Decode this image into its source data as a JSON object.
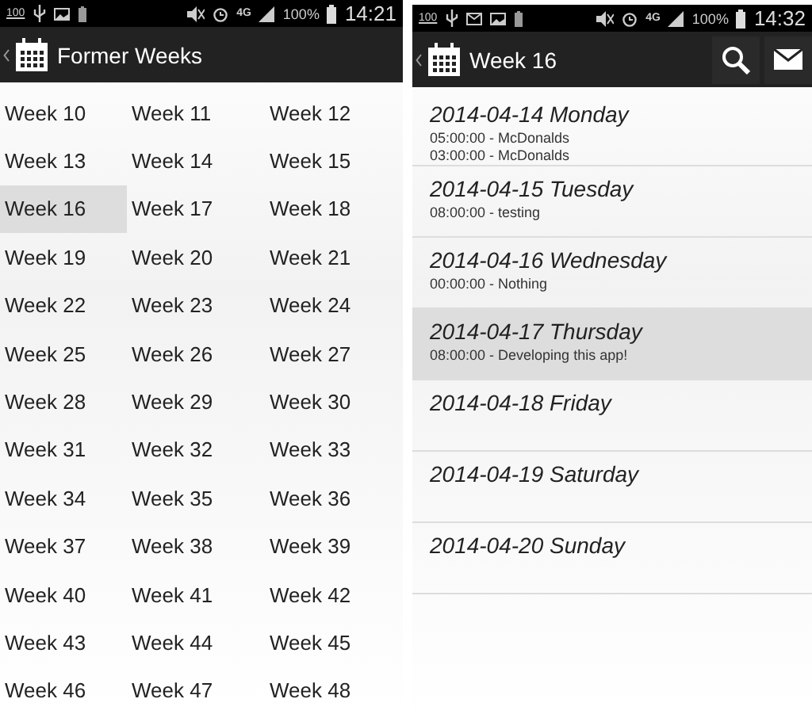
{
  "screens": [
    {
      "kind": "weeks",
      "status_bar": {
        "left_text": "100",
        "network": "4G",
        "battery": "100%",
        "time": "14:21"
      },
      "action_bar": {
        "title": "Former Weeks"
      },
      "weeks": [
        {
          "label": "Week 10",
          "selected": false
        },
        {
          "label": "Week 11",
          "selected": false
        },
        {
          "label": "Week 12",
          "selected": false
        },
        {
          "label": "Week 13",
          "selected": false
        },
        {
          "label": "Week 14",
          "selected": false
        },
        {
          "label": "Week 15",
          "selected": false
        },
        {
          "label": "Week 16",
          "selected": true
        },
        {
          "label": "Week 17",
          "selected": false
        },
        {
          "label": "Week 18",
          "selected": false
        },
        {
          "label": "Week 19",
          "selected": false
        },
        {
          "label": "Week 20",
          "selected": false
        },
        {
          "label": "Week 21",
          "selected": false
        },
        {
          "label": "Week 22",
          "selected": false
        },
        {
          "label": "Week 23",
          "selected": false
        },
        {
          "label": "Week 24",
          "selected": false
        },
        {
          "label": "Week 25",
          "selected": false
        },
        {
          "label": "Week 26",
          "selected": false
        },
        {
          "label": "Week 27",
          "selected": false
        },
        {
          "label": "Week 28",
          "selected": false
        },
        {
          "label": "Week 29",
          "selected": false
        },
        {
          "label": "Week 30",
          "selected": false
        },
        {
          "label": "Week 31",
          "selected": false
        },
        {
          "label": "Week 32",
          "selected": false
        },
        {
          "label": "Week 33",
          "selected": false
        },
        {
          "label": "Week 34",
          "selected": false
        },
        {
          "label": "Week 35",
          "selected": false
        },
        {
          "label": "Week 36",
          "selected": false
        },
        {
          "label": "Week 37",
          "selected": false
        },
        {
          "label": "Week 38",
          "selected": false
        },
        {
          "label": "Week 39",
          "selected": false
        },
        {
          "label": "Week 40",
          "selected": false
        },
        {
          "label": "Week 41",
          "selected": false
        },
        {
          "label": "Week 42",
          "selected": false
        },
        {
          "label": "Week 43",
          "selected": false
        },
        {
          "label": "Week 44",
          "selected": false
        },
        {
          "label": "Week 45",
          "selected": false
        },
        {
          "label": "Week 46",
          "selected": false
        },
        {
          "label": "Week 47",
          "selected": false
        },
        {
          "label": "Week 48",
          "selected": false
        }
      ]
    },
    {
      "kind": "days",
      "status_bar": {
        "left_text": "100",
        "network": "4G",
        "battery": "100%",
        "time": "14:32"
      },
      "action_bar": {
        "title": "Week 16",
        "actions": [
          {
            "kind": "search"
          },
          {
            "kind": "mail"
          }
        ]
      },
      "days": [
        {
          "date": "2014-04-14 Monday",
          "entries": [
            "05:00:00 - McDonalds",
            "03:00:00 - McDonalds"
          ],
          "selected": false
        },
        {
          "date": "2014-04-15 Tuesday",
          "entries": [
            "08:00:00 - testing"
          ],
          "selected": false
        },
        {
          "date": "2014-04-16 Wednesday",
          "entries": [
            "00:00:00 - Nothing"
          ],
          "selected": false
        },
        {
          "date": "2014-04-17 Thursday",
          "entries": [
            "08:00:00 - Developing this app!"
          ],
          "selected": true
        },
        {
          "date": "2014-04-18 Friday",
          "selected": false
        },
        {
          "date": "2014-04-19 Saturday",
          "selected": false
        },
        {
          "date": "2014-04-20 Sunday",
          "selected": false
        }
      ]
    }
  ]
}
